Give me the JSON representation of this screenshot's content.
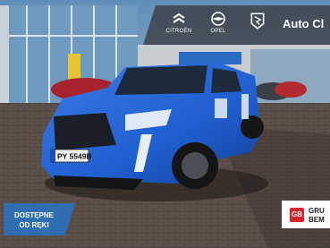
{
  "header": {
    "brands": [
      {
        "name": "CITROËN",
        "icon": "citroen-logo-icon"
      },
      {
        "name": "OPEL",
        "icon": "opel-logo-icon"
      },
      {
        "name": "",
        "icon": "peugeot-logo-icon"
      }
    ],
    "dealer_name": "Auto Cl"
  },
  "plate": "PY 5549B",
  "badge_availability": {
    "line1": "DOSTĘPNE",
    "line2": "OD RĘKI"
  },
  "group_logo": {
    "icon_text": "GB",
    "line1": "GRU",
    "line2": "BEM"
  },
  "colors": {
    "car_body": "#1f5fd0",
    "badge_blue": "#2f6fb1",
    "group_red": "#d8232a"
  }
}
